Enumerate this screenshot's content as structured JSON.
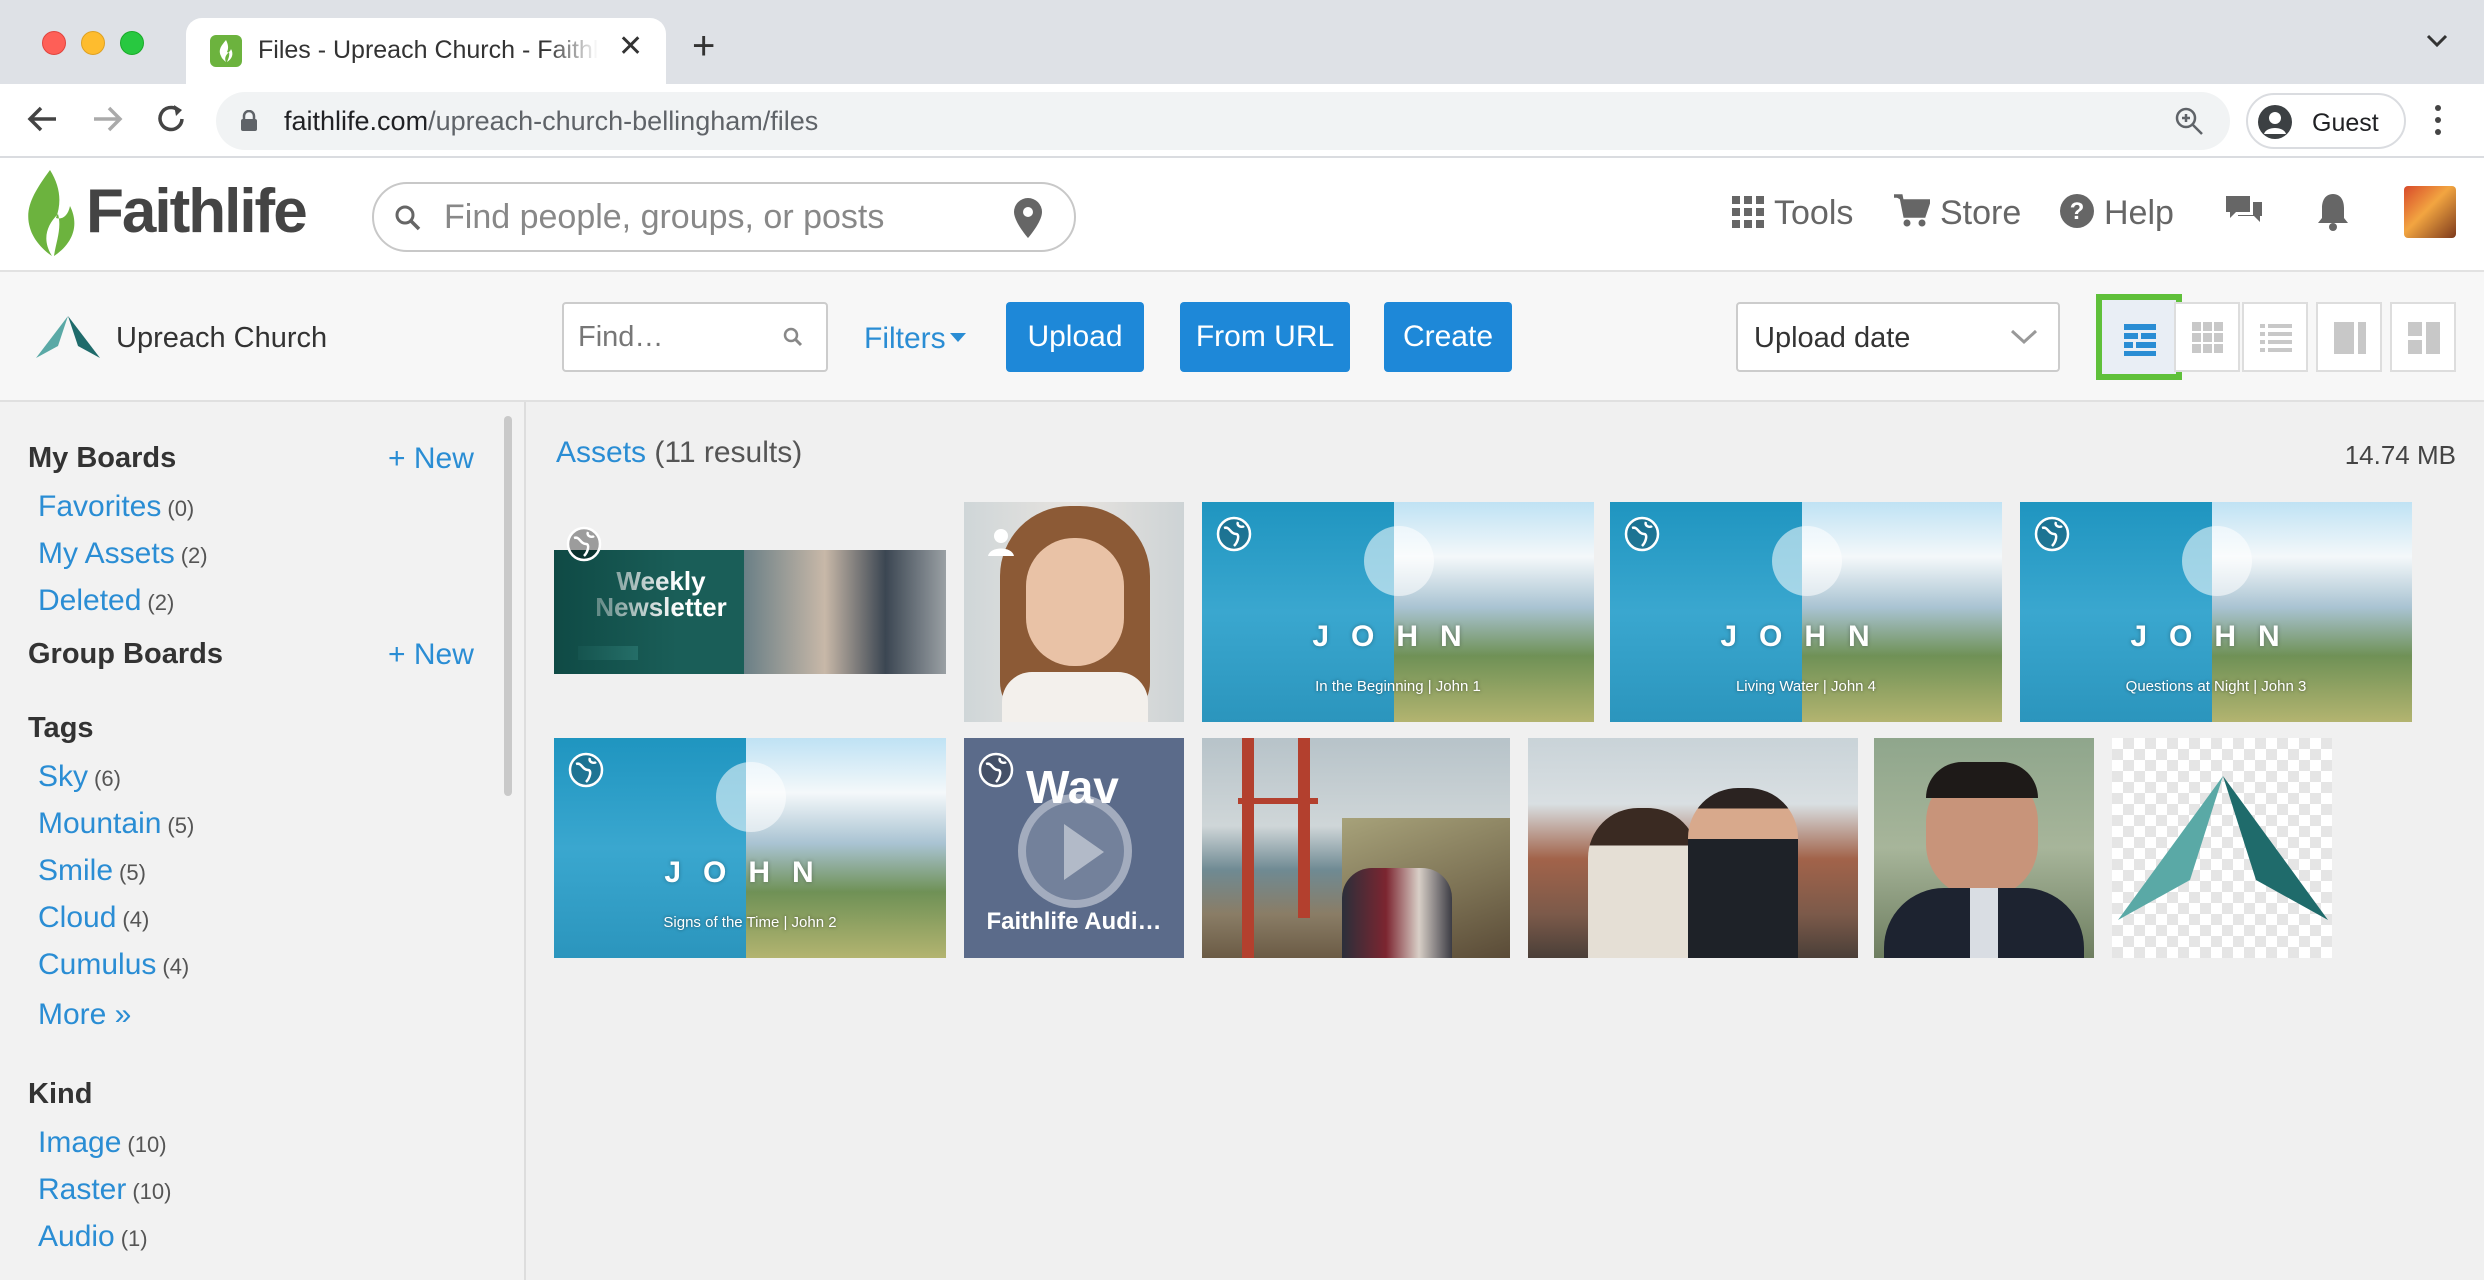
{
  "browser": {
    "tab_title": "Files - Upreach Church - Faithlife",
    "url_host": "faithlife.com",
    "url_path": "/upreach-church-bellingham/files",
    "profile_label": "Guest"
  },
  "header": {
    "logo_text": "Faithlife",
    "search_placeholder": "Find people, groups, or posts",
    "tools_label": "Tools",
    "store_label": "Store",
    "help_label": "Help"
  },
  "files_bar": {
    "church_name": "Upreach Church",
    "find_placeholder": "Find…",
    "filters_label": "Filters",
    "upload_label": "Upload",
    "from_url_label": "From URL",
    "create_label": "Create",
    "sort_value": "Upload date"
  },
  "sidebar": {
    "my_boards_title": "My Boards",
    "my_boards_new": "+ New",
    "my_boards": [
      {
        "label": "Favorites",
        "count": "(0)"
      },
      {
        "label": "My Assets",
        "count": "(2)"
      },
      {
        "label": "Deleted",
        "count": "(2)"
      }
    ],
    "group_boards_title": "Group Boards",
    "group_boards_new": "+ New",
    "tags_title": "Tags",
    "tags": [
      {
        "label": "Sky",
        "count": "(6)"
      },
      {
        "label": "Mountain",
        "count": "(5)"
      },
      {
        "label": "Smile",
        "count": "(5)"
      },
      {
        "label": "Cloud",
        "count": "(4)"
      },
      {
        "label": "Cumulus",
        "count": "(4)"
      }
    ],
    "tags_more": "More »",
    "kind_title": "Kind",
    "kinds": [
      {
        "label": "Image",
        "count": "(10)"
      },
      {
        "label": "Raster",
        "count": "(10)"
      },
      {
        "label": "Audio",
        "count": "(1)"
      }
    ]
  },
  "main": {
    "assets_link": "Assets",
    "results": "(11 results)",
    "total_size": "14.74 MB",
    "newsletter_text": "Weekly Newsletter",
    "john_word": "JOHN",
    "john_subtitles": [
      "In the Beginning | John 1",
      "Living Water | John 4",
      "Questions at Night | John 3",
      "Signs of the Time | John 2"
    ],
    "audio_top": "Wav",
    "audio_label": "Faithlife Audi…"
  }
}
